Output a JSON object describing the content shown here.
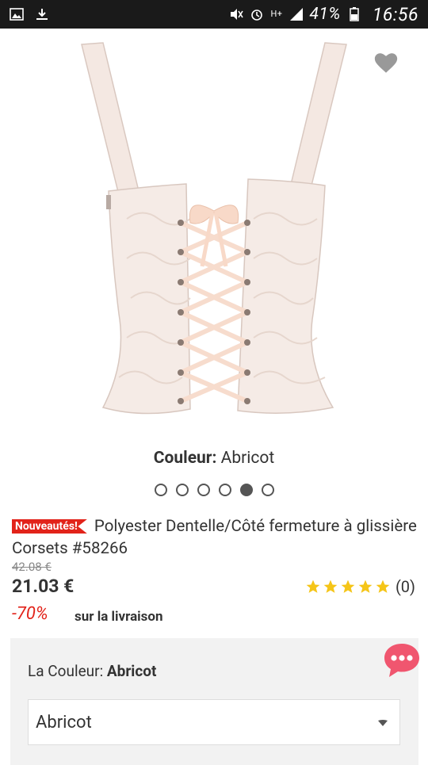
{
  "status_bar": {
    "battery_percent": "41%",
    "time": "16:56",
    "signal_label": "H+"
  },
  "product": {
    "color_caption_label": "Couleur:",
    "color_caption_value": "Abricot",
    "image_count": 6,
    "active_image_index": 4,
    "badge": "Nouveautés!",
    "title": "Polyester Dentelle/Côté fermeture à glissière Corsets #58266",
    "old_price": "42.08 €",
    "price": "21.03 €",
    "rating_stars": 5,
    "reviews": "(0)",
    "discount": "-70%",
    "shipping": "sur la livraison"
  },
  "options": {
    "color_label": "La Couleur:",
    "color_value": "Abricot",
    "select_value": "Abricot"
  },
  "colors": {
    "accent_red": "#e2231a",
    "star_gold": "#f5c518",
    "heart_gray": "#999999",
    "chat_pink": "#f0566f"
  },
  "icons": [
    "image-icon",
    "download-icon",
    "mute-icon",
    "alarm-icon",
    "signal-icon",
    "battery-icon",
    "heart-icon",
    "star-icon",
    "chevron-down-icon",
    "chat-icon"
  ]
}
